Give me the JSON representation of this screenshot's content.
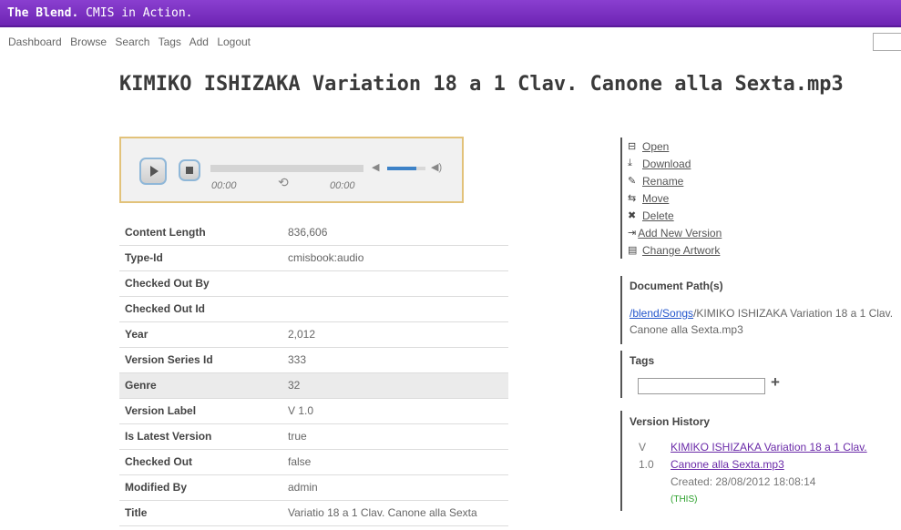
{
  "header": {
    "brand_bold": "The Blend.",
    "brand_rest": "CMIS in Action."
  },
  "nav": [
    "Dashboard",
    "Browse",
    "Search",
    "Tags",
    "Add",
    "Logout"
  ],
  "document": {
    "title": "KIMIKO ISHIZAKA Variation 18 a 1 Clav. Canone alla Sexta.mp3"
  },
  "player": {
    "current_time": "00:00",
    "duration": "00:00",
    "volume_level": 0.75
  },
  "properties": [
    {
      "key": "Content Length",
      "value": "836,606"
    },
    {
      "key": "Type-Id",
      "value": "cmisbook:audio"
    },
    {
      "key": "Checked Out By",
      "value": ""
    },
    {
      "key": "Checked Out Id",
      "value": ""
    },
    {
      "key": "Year",
      "value": "2,012"
    },
    {
      "key": "Version Series Id",
      "value": "333"
    },
    {
      "key": "Genre",
      "value": "32"
    },
    {
      "key": "Version Label",
      "value": "V 1.0"
    },
    {
      "key": "Is Latest Version",
      "value": "true"
    },
    {
      "key": "Checked Out",
      "value": "false"
    },
    {
      "key": "Modified By",
      "value": "admin"
    },
    {
      "key": "Title",
      "value": "Variatio 18 a 1 Clav. Canone alla Sexta"
    }
  ],
  "actions": [
    {
      "label": "Open",
      "icon": "open-icon",
      "glyph": "⊟"
    },
    {
      "label": "Download",
      "icon": "download-icon",
      "glyph": "⤓"
    },
    {
      "label": "Rename",
      "icon": "rename-icon",
      "glyph": "✎"
    },
    {
      "label": "Move",
      "icon": "move-icon",
      "glyph": "⇆"
    },
    {
      "label": "Delete",
      "icon": "delete-icon",
      "glyph": "✖"
    },
    {
      "label": "Add New Version",
      "icon": "add-version-icon",
      "glyph": "⇥"
    },
    {
      "label": "Change Artwork",
      "icon": "artwork-icon",
      "glyph": "▤"
    }
  ],
  "doc_path": {
    "heading": "Document Path(s)",
    "link": "/blend/Songs",
    "rest": "/KIMIKO ISHIZAKA Variation 18 a 1 Clav. Canone alla Sexta.mp3"
  },
  "tags": {
    "heading": "Tags",
    "add_label": "+"
  },
  "version_history": {
    "heading": "Version History",
    "version_v": "V",
    "version_num": "1.0",
    "link_line1": "KIMIKO ISHIZAKA Variation 18 a 1 Clav.",
    "link_line2": "Canone alla Sexta.mp3",
    "created": "Created: 28/08/2012 18:08:14",
    "this_label": "(THIS)"
  }
}
